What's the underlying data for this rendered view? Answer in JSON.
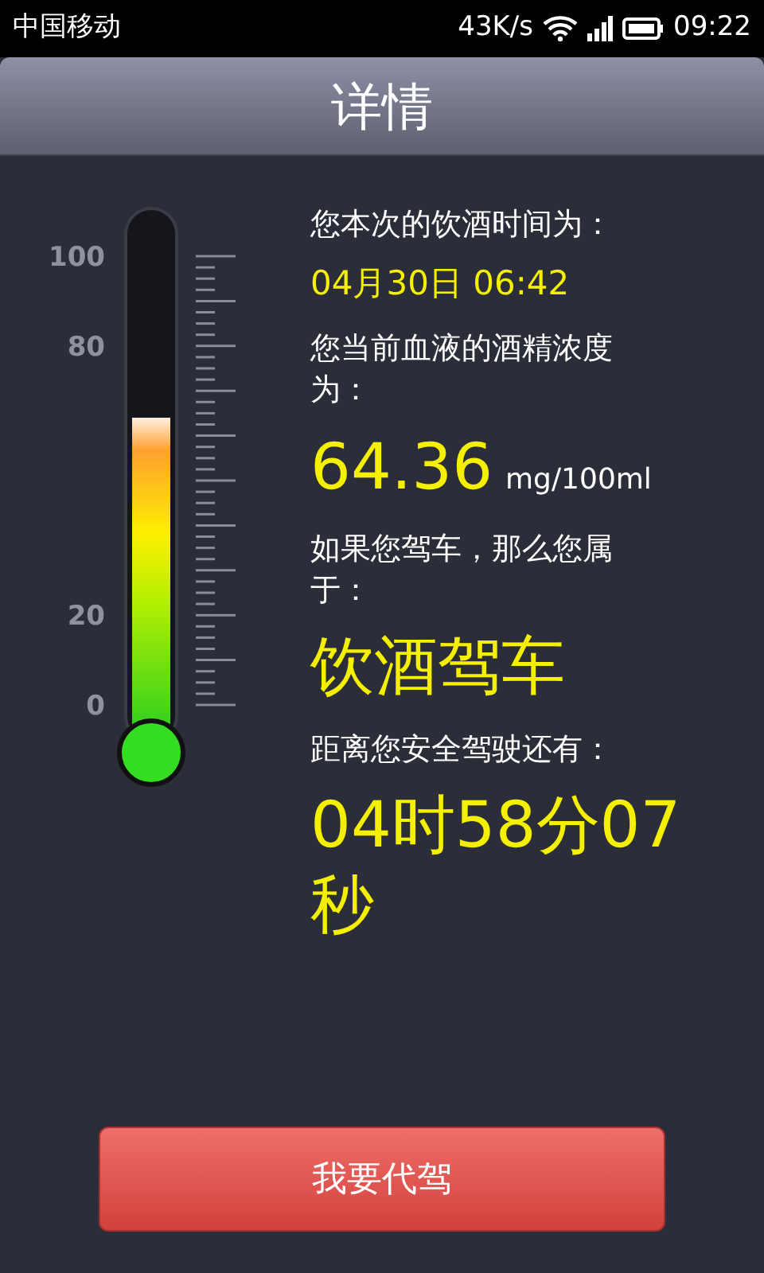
{
  "status_bar": {
    "carrier": "中国移动",
    "speed": "43K/s",
    "time": "09:22"
  },
  "title": "详情",
  "thermometer": {
    "level": 0.64,
    "scale_labels": [
      "100",
      "80",
      "20",
      "0"
    ]
  },
  "details": [
    {
      "kind": "label",
      "text": "您本次的饮酒时间为："
    },
    {
      "kind": "value",
      "text": "04月30日 06:42"
    },
    {
      "kind": "label",
      "text": "您当前血液的酒精浓度为："
    },
    {
      "kind": "reading",
      "text": "64.36",
      "unit": "mg/100ml"
    },
    {
      "kind": "label",
      "text": "如果您驾车，那么您属于："
    },
    {
      "kind": "big",
      "text": "饮酒驾车"
    },
    {
      "kind": "label",
      "text": "距离您安全驾驶还有："
    },
    {
      "kind": "big",
      "text": "04时58分07秒"
    }
  ],
  "button": "我要代驾"
}
